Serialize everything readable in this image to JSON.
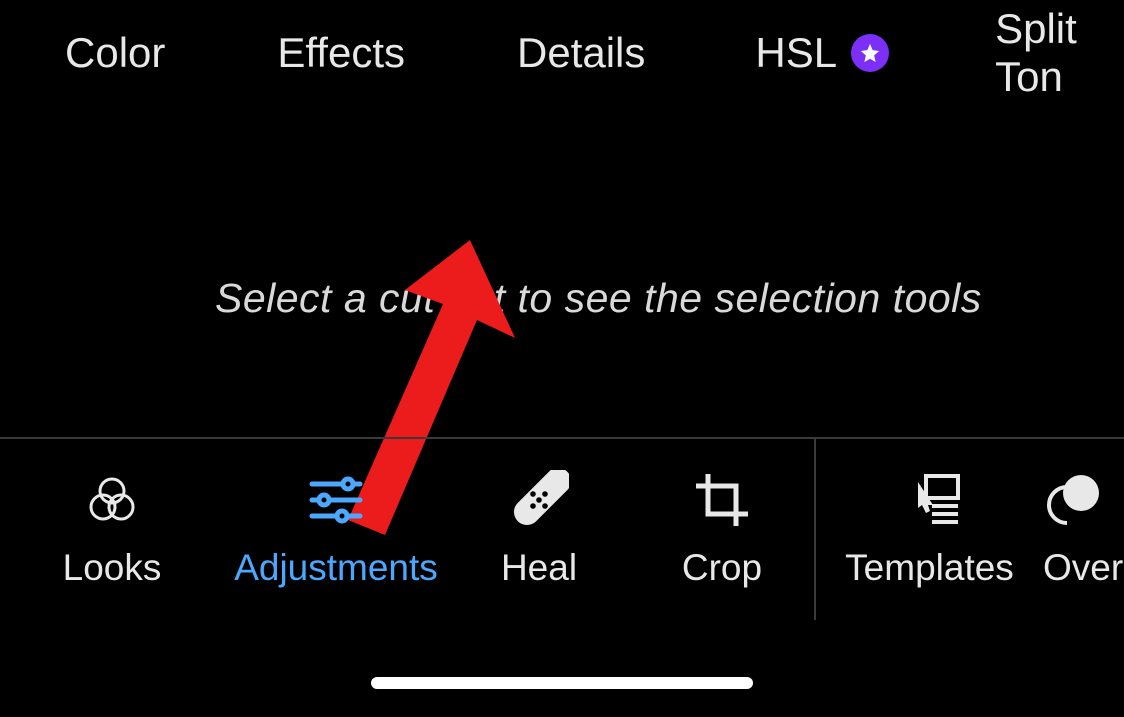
{
  "topTabs": {
    "color": "Color",
    "effects": "Effects",
    "details": "Details",
    "hsl": "HSL",
    "splitTon": "Split Ton"
  },
  "canvas": {
    "hint": "Select a cut out to see the selection tools"
  },
  "toolbar": {
    "looks": "Looks",
    "adjustments": "Adjustments",
    "heal": "Heal",
    "crop": "Crop",
    "templates": "Templates",
    "overlays": "Over"
  },
  "colors": {
    "accent": "#4aa8ff",
    "premium_badge": "#7b2ff7",
    "annotation_arrow": "#ed1c1c"
  }
}
